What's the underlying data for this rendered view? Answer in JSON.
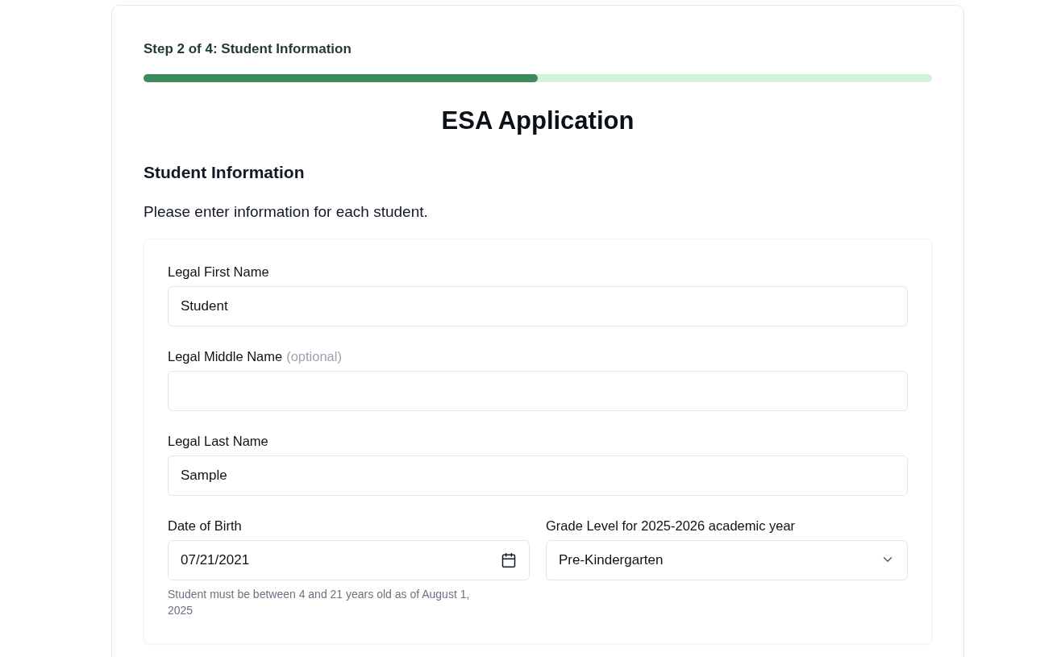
{
  "progress": {
    "label": "Step 2 of 4: Student Information",
    "level": 0.5
  },
  "title": "ESA Application",
  "section": {
    "heading": "Student Information",
    "intro": "Please enter information for each student."
  },
  "student_form": {
    "rows": [
      {
        "fields": [
          {
            "kind": "text",
            "label": "Legal First Name",
            "value": "Student"
          }
        ]
      },
      {
        "fields": [
          {
            "kind": "text",
            "label": "Legal Middle Name",
            "note": "(optional)"
          }
        ]
      },
      {
        "fields": [
          {
            "kind": "text",
            "label": "Legal Last Name",
            "value": "Sample"
          }
        ]
      },
      {
        "fields": [
          {
            "kind": "date",
            "label": "Date of Birth",
            "value": "07/21/2021",
            "help": "Student must be between 4 and 21 years old as of August 1, 2025"
          },
          {
            "kind": "select",
            "label": "Grade Level for 2025-2026 academic year",
            "value": "Pre-Kindergarten"
          }
        ]
      }
    ]
  }
}
